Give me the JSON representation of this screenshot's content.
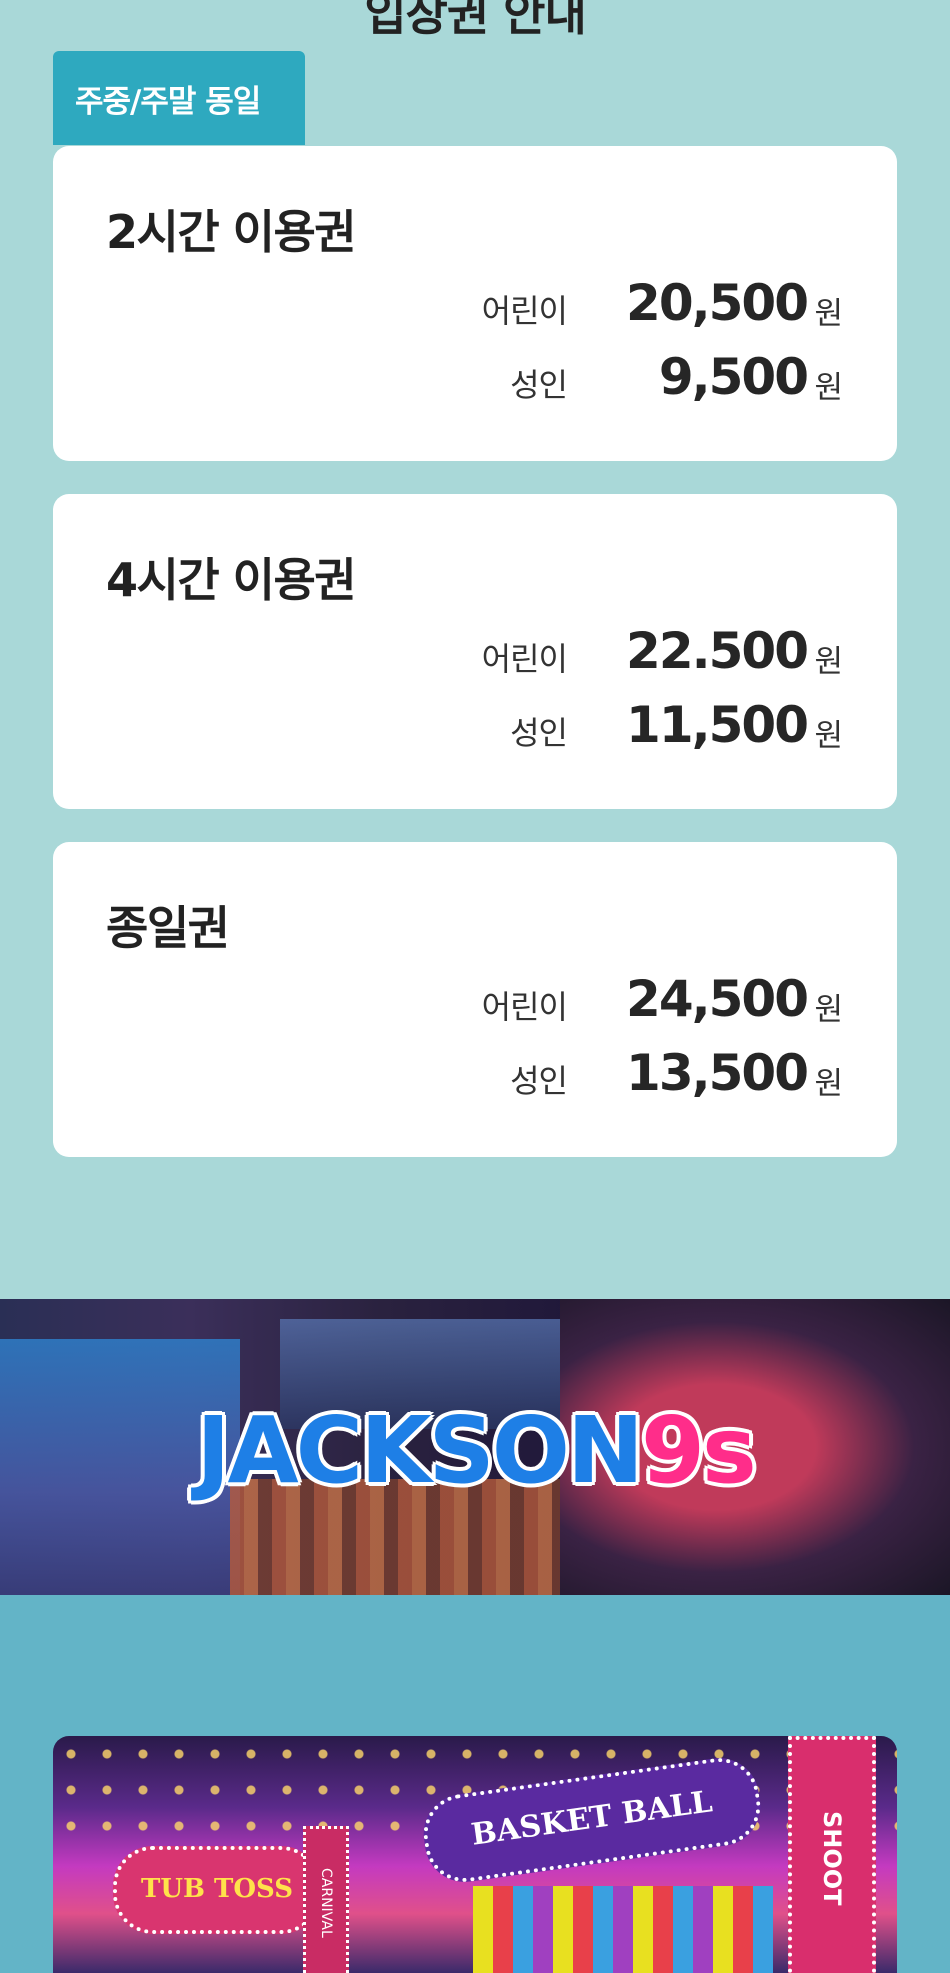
{
  "section": {
    "heading": "입장권 안내",
    "tag": "주중/주말 동일"
  },
  "tickets": [
    {
      "title": "2시간 이용권",
      "prices": [
        {
          "label": "어린이",
          "amount": "20,500",
          "unit": "원"
        },
        {
          "label": "성인",
          "amount": "9,500",
          "unit": "원"
        }
      ]
    },
    {
      "title": "4시간 이용권",
      "prices": [
        {
          "label": "어린이",
          "amount": "22.500",
          "unit": "원"
        },
        {
          "label": "성인",
          "amount": "11,500",
          "unit": "원"
        }
      ]
    },
    {
      "title": "종일권",
      "prices": [
        {
          "label": "어린이",
          "amount": "24,500",
          "unit": "원"
        },
        {
          "label": "성인",
          "amount": "13,500",
          "unit": "원"
        }
      ]
    }
  ],
  "banner": {
    "logo_main": "JACKSON",
    "logo_accent": "9s"
  },
  "photo": {
    "sign_left": "TUB TOSS",
    "sign_center": "BASKET BALL",
    "sign_right": "SHOOT",
    "sign_small": "CARNIVAL"
  },
  "colors": {
    "page_bg": "#a9d8d8",
    "tag_bg": "#2ea9bf",
    "bottom_bg": "#63b4c7",
    "logo_blue": "#1e7fe6",
    "logo_pink": "#ff2d8a"
  }
}
